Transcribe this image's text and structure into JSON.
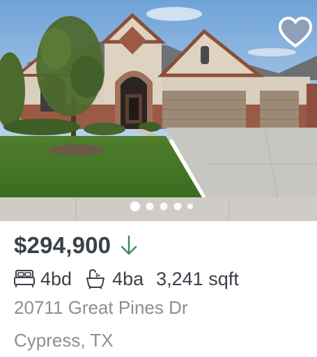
{
  "listing": {
    "photo_name": "house-photo",
    "carousel": {
      "total_dots": 5,
      "active_index": 0
    },
    "favorite_icon": "heart-icon",
    "price": "$294,900",
    "price_trend_icon": "arrow-down-icon",
    "price_trend_color": "#3a8a5f",
    "beds": "4bd",
    "baths": "4ba",
    "sqft": "3,241 sqft",
    "address_line1": "20711 Great Pines Dr",
    "address_line2": "Cypress, TX"
  }
}
